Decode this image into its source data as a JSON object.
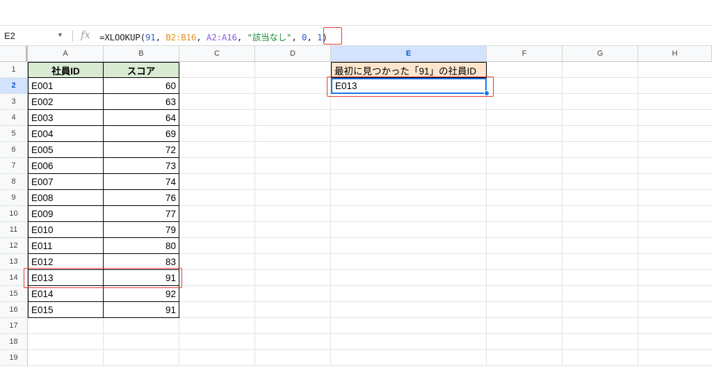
{
  "name_box": "E2",
  "fx_label": "fx",
  "formula": {
    "p1": "=XLOOKUP(",
    "n1": "91",
    "c1": ", ",
    "r1": "B2:B16",
    "c2": ", ",
    "r2": "A2:A16",
    "c3": ", ",
    "s1": "\"該当なし\"",
    "c4": ", ",
    "n2": "0",
    "c5": ", ",
    "n3": "1",
    "p2": ")"
  },
  "columns": [
    "A",
    "B",
    "C",
    "D",
    "E",
    "F",
    "G",
    "H"
  ],
  "active_column": "E",
  "row_numbers": [
    "1",
    "2",
    "3",
    "4",
    "5",
    "6",
    "7",
    "8",
    "9",
    "10",
    "11",
    "12",
    "13",
    "14",
    "15",
    "16",
    "17",
    "18",
    "19"
  ],
  "active_row": "2",
  "table": {
    "header_id": "社員ID",
    "header_score": "スコア",
    "rows": [
      {
        "id": "E001",
        "score": "60"
      },
      {
        "id": "E002",
        "score": "63"
      },
      {
        "id": "E003",
        "score": "64"
      },
      {
        "id": "E004",
        "score": "69"
      },
      {
        "id": "E005",
        "score": "72"
      },
      {
        "id": "E006",
        "score": "73"
      },
      {
        "id": "E007",
        "score": "74"
      },
      {
        "id": "E008",
        "score": "76"
      },
      {
        "id": "E009",
        "score": "77"
      },
      {
        "id": "E010",
        "score": "79"
      },
      {
        "id": "E011",
        "score": "80"
      },
      {
        "id": "E012",
        "score": "83"
      },
      {
        "id": "E013",
        "score": "91"
      },
      {
        "id": "E014",
        "score": "92"
      },
      {
        "id": "E015",
        "score": "91"
      }
    ]
  },
  "result": {
    "header": "最初に見つかった「91」の社員ID",
    "value": "E013"
  },
  "colors": {
    "header_green": "#d9ead3",
    "header_orange": "#fce5cd",
    "highlight_red": "#e53935",
    "selection_blue": "#1a73e8"
  }
}
